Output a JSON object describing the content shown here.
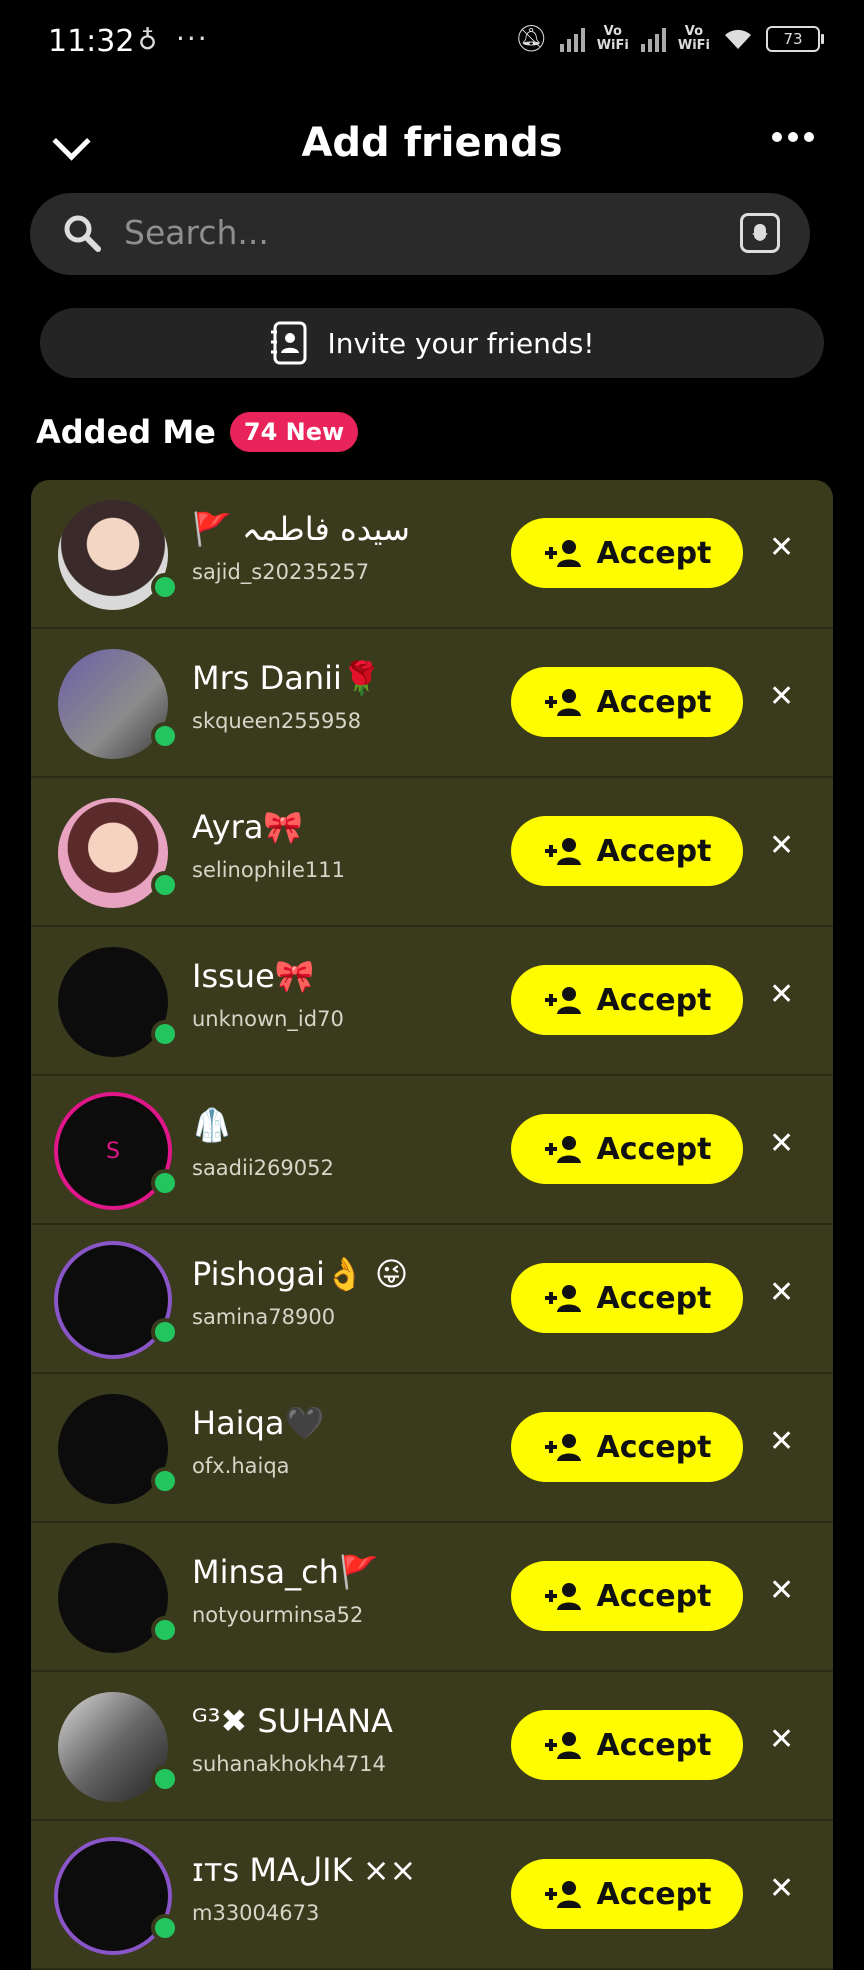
{
  "status_bar": {
    "time": "11:32",
    "alarm_glyph": "♁",
    "more_glyph": "···",
    "vowifi_1": "Vo\nWiFi",
    "vowifi_2": "Vo\nWiFi",
    "battery": "73"
  },
  "header": {
    "title": "Add friends"
  },
  "search": {
    "placeholder": "Search..."
  },
  "invite": {
    "label": "Invite your friends!"
  },
  "added_me": {
    "title": "Added Me",
    "badge": "74 New",
    "accept_label": "Accept",
    "requests": [
      {
        "name": "🚩 سیده فاطمہ",
        "username": "sajid_s20235257",
        "avatar": "face-light"
      },
      {
        "name": "Mrs Danii🌹",
        "username": "skqueen255958",
        "avatar": "photo-1"
      },
      {
        "name": "Ayra🎀",
        "username": "selinophile111",
        "avatar": "face-pink"
      },
      {
        "name": "Issue🎀",
        "username": "unknown_id70",
        "avatar": "blank"
      },
      {
        "name": "🥼",
        "username": "saadii269052",
        "avatar": "initial",
        "initial": "S"
      },
      {
        "name": "Pishogai👌 😜",
        "username": "samina78900",
        "avatar": "blank-purple"
      },
      {
        "name": "Haiqa🖤",
        "username": "ofx.haiqa",
        "avatar": "blank"
      },
      {
        "name": "Minsa_ch🚩",
        "username": "notyourminsa52",
        "avatar": "blank"
      },
      {
        "name": "ᴳ³✖ SUHANA",
        "username": "suhanakhokh4714",
        "avatar": "photo-2"
      },
      {
        "name": "ɪᴛs MAلIK ××",
        "username": "m33004673",
        "avatar": "blank-purple"
      }
    ]
  },
  "colors": {
    "accent_yellow": "#fffc00",
    "badge_pink": "#e8245b",
    "list_bg": "#3a3a1d",
    "online_green": "#22c55e"
  }
}
